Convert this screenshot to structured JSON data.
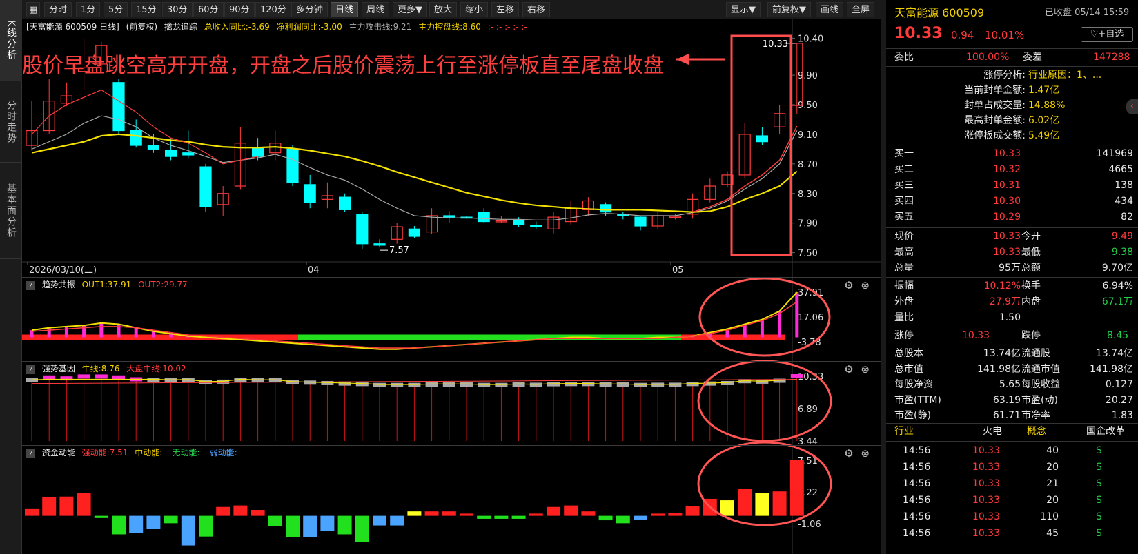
{
  "left_tabs": [
    "K线分析",
    "分时走势",
    "基本面分析"
  ],
  "toolbar": {
    "periods": [
      "分时",
      "1分",
      "5分",
      "15分",
      "30分",
      "60分",
      "90分",
      "120分",
      "多分钟",
      "日线",
      "周线",
      "更多▼",
      "放大",
      "缩小",
      "左移",
      "右移"
    ],
    "active": "日线",
    "right_buttons": [
      "显示▼",
      "前复权▼",
      "画线",
      "全屏"
    ]
  },
  "info_bar": {
    "title": "[天富能源 600509 日线]",
    "adj": "(前复权)",
    "indicator": "擒龙追踪",
    "rev_yoy": "总收入同比:-3.69",
    "profit_yoy": "净利润同比:-3.00",
    "attack": "主力攻击线:9.21",
    "control": "主力控盘线:8.60",
    "extra": ":- :- :- :- :-"
  },
  "annotation": "股价早盘跳空高开开盘，开盘之后股价震荡上行至涨停板直至尾盘收盘",
  "price_axis": [
    "10.40",
    "9.90",
    "9.50",
    "9.10",
    "8.70",
    "8.30",
    "7.90",
    "7.50"
  ],
  "date_labels": [
    "2026/03/10(二)",
    "04",
    "05"
  ],
  "high_label": "10.33",
  "low_label": "7.57",
  "panel1": {
    "name": "趋势共振",
    "out1": "OUT1:37.91",
    "out2": "OUT2:29.77",
    "axis": [
      "37.91",
      "17.06",
      "-3.78"
    ]
  },
  "panel2": {
    "name": "强势基因",
    "bull": "牛线:8.76",
    "mid": "大盘中线:10.02",
    "axis": [
      "10.33",
      "6.89",
      "3.44"
    ]
  },
  "panel3": {
    "name": "资金动能",
    "strong": "强动能:7.51",
    "medium": "中动能:-",
    "none": "无动能:-",
    "weak": "弱动能:-",
    "axis": [
      "7.51",
      "3.22",
      "-1.06"
    ]
  },
  "colors": {
    "up": "#ff3b3b",
    "down": "#00ffff",
    "ma_short": "#ff3b3b",
    "ma_mid": "#f1e000",
    "ma_long": "#aaaaaa"
  },
  "chart_data": [
    {
      "type": "candlestick",
      "title": "天富能源 600509 日线",
      "ohlc": [
        {
          "o": 8.95,
          "h": 9.55,
          "l": 8.88,
          "c": 9.15
        },
        {
          "o": 9.15,
          "h": 9.85,
          "l": 9.1,
          "c": 9.55
        },
        {
          "o": 9.52,
          "h": 9.8,
          "l": 9.48,
          "c": 9.62
        },
        {
          "o": 9.95,
          "h": 10.4,
          "l": 9.7,
          "c": 10.0
        },
        {
          "o": 10.05,
          "h": 10.35,
          "l": 9.95,
          "c": 10.3
        },
        {
          "o": 9.8,
          "h": 9.85,
          "l": 9.1,
          "c": 9.15
        },
        {
          "o": 9.15,
          "h": 9.3,
          "l": 8.92,
          "c": 8.95
        },
        {
          "o": 8.95,
          "h": 9.1,
          "l": 8.85,
          "c": 8.9
        },
        {
          "o": 8.88,
          "h": 9.05,
          "l": 8.75,
          "c": 8.8
        },
        {
          "o": 8.85,
          "h": 9.15,
          "l": 8.78,
          "c": 8.82
        },
        {
          "o": 8.66,
          "h": 8.7,
          "l": 8.05,
          "c": 8.12
        },
        {
          "o": 8.15,
          "h": 8.4,
          "l": 8.0,
          "c": 8.3
        },
        {
          "o": 8.4,
          "h": 9.2,
          "l": 8.35,
          "c": 8.98
        },
        {
          "o": 8.92,
          "h": 9.05,
          "l": 8.75,
          "c": 8.8
        },
        {
          "o": 8.85,
          "h": 9.15,
          "l": 8.75,
          "c": 8.98
        },
        {
          "o": 8.9,
          "h": 8.95,
          "l": 8.4,
          "c": 8.45
        },
        {
          "o": 8.42,
          "h": 8.55,
          "l": 8.1,
          "c": 8.18
        },
        {
          "o": 8.22,
          "h": 8.45,
          "l": 8.1,
          "c": 8.27
        },
        {
          "o": 8.25,
          "h": 8.3,
          "l": 8.05,
          "c": 8.08
        },
        {
          "o": 8.02,
          "h": 8.05,
          "l": 7.55,
          "c": 7.62
        },
        {
          "o": 7.62,
          "h": 7.68,
          "l": 7.57,
          "c": 7.6
        },
        {
          "o": 7.68,
          "h": 7.9,
          "l": 7.62,
          "c": 7.85
        },
        {
          "o": 7.82,
          "h": 7.86,
          "l": 7.7,
          "c": 7.72
        },
        {
          "o": 7.78,
          "h": 8.1,
          "l": 7.75,
          "c": 8.0
        },
        {
          "o": 8.0,
          "h": 8.06,
          "l": 7.9,
          "c": 7.98
        },
        {
          "o": 7.98,
          "h": 8.0,
          "l": 7.96,
          "c": 7.97
        },
        {
          "o": 8.05,
          "h": 8.1,
          "l": 7.9,
          "c": 7.92
        },
        {
          "o": 7.92,
          "h": 8.0,
          "l": 7.9,
          "c": 7.93
        },
        {
          "o": 7.94,
          "h": 7.98,
          "l": 7.85,
          "c": 7.88
        },
        {
          "o": 7.87,
          "h": 7.92,
          "l": 7.82,
          "c": 7.85
        },
        {
          "o": 7.82,
          "h": 8.05,
          "l": 7.76,
          "c": 7.98
        },
        {
          "o": 7.92,
          "h": 8.2,
          "l": 7.88,
          "c": 8.1
        },
        {
          "o": 8.08,
          "h": 8.25,
          "l": 8.0,
          "c": 8.2
        },
        {
          "o": 8.15,
          "h": 8.18,
          "l": 8.0,
          "c": 8.05
        },
        {
          "o": 8.02,
          "h": 8.05,
          "l": 7.95,
          "c": 8.0
        },
        {
          "o": 7.98,
          "h": 8.0,
          "l": 7.8,
          "c": 7.86
        },
        {
          "o": 7.86,
          "h": 8.05,
          "l": 7.82,
          "c": 8.0
        },
        {
          "o": 7.98,
          "h": 8.02,
          "l": 7.95,
          "c": 7.99
        },
        {
          "o": 8.02,
          "h": 8.3,
          "l": 7.96,
          "c": 8.22
        },
        {
          "o": 8.22,
          "h": 8.5,
          "l": 8.18,
          "c": 8.4
        },
        {
          "o": 8.42,
          "h": 8.6,
          "l": 8.38,
          "c": 8.55
        },
        {
          "o": 8.55,
          "h": 9.25,
          "l": 8.5,
          "c": 9.1
        },
        {
          "o": 9.08,
          "h": 9.2,
          "l": 8.95,
          "c": 9.0
        },
        {
          "o": 9.2,
          "h": 9.5,
          "l": 9.1,
          "c": 9.38
        },
        {
          "o": 9.49,
          "h": 10.33,
          "l": 9.38,
          "c": 10.33
        }
      ],
      "ma_attack": [
        9.1,
        9.35,
        9.5,
        9.6,
        9.7,
        9.55,
        9.4,
        9.2,
        9.05,
        8.98,
        8.85,
        8.7,
        8.75,
        8.8,
        8.88,
        8.78,
        8.65,
        8.58,
        8.5,
        8.38,
        8.25,
        8.15,
        8.05,
        8.02,
        8.0,
        8.0,
        7.98,
        7.97,
        7.96,
        7.95,
        7.95,
        7.98,
        8.02,
        8.04,
        8.03,
        8.0,
        8.0,
        8.0,
        8.05,
        8.12,
        8.22,
        8.4,
        8.55,
        8.75,
        9.21
      ],
      "ma_control": [
        8.85,
        8.9,
        8.95,
        9.0,
        9.08,
        9.1,
        9.08,
        9.05,
        9.02,
        9.0,
        8.96,
        8.93,
        8.92,
        8.92,
        8.93,
        8.91,
        8.88,
        8.84,
        8.8,
        8.74,
        8.67,
        8.59,
        8.52,
        8.45,
        8.38,
        8.31,
        8.26,
        8.21,
        8.17,
        8.14,
        8.12,
        8.1,
        8.09,
        8.08,
        8.08,
        8.08,
        8.07,
        8.06,
        8.05,
        8.06,
        8.12,
        8.22,
        8.3,
        8.4,
        8.6
      ],
      "ma_long": [
        8.9,
        9.0,
        9.1,
        9.25,
        9.35,
        9.3,
        9.2,
        9.05,
        8.95,
        8.88,
        8.8,
        8.72,
        8.75,
        8.78,
        8.83,
        8.76,
        8.65,
        8.55,
        8.48,
        8.36,
        8.22,
        8.1,
        8.0,
        7.98,
        7.97,
        7.97,
        7.96,
        7.95,
        7.95,
        7.94,
        7.94,
        7.97,
        8.01,
        8.03,
        8.02,
        8.0,
        8.0,
        8.0,
        8.04,
        8.1,
        8.2,
        8.36,
        8.5,
        8.7,
        9.15
      ]
    },
    {
      "type": "bar",
      "title": "趋势共振",
      "values": [
        6,
        8,
        9,
        10,
        12,
        11,
        8,
        5,
        3,
        1,
        0,
        -1,
        -2,
        -3,
        -4,
        -5,
        -6,
        -7,
        -8,
        -9,
        -10,
        -10,
        -9,
        -8,
        -7,
        -6,
        -5,
        -4,
        -3,
        -2,
        -1,
        0,
        0,
        -1,
        -1,
        -1,
        0,
        0,
        1,
        4,
        7,
        11,
        15,
        22,
        37.91
      ],
      "signal": [
        5,
        6,
        7,
        8,
        9,
        9,
        8,
        6,
        4,
        2,
        1,
        0,
        -1,
        -2,
        -3,
        -4,
        -5,
        -6,
        -7,
        -8,
        -9,
        -9,
        -9,
        -8,
        -7,
        -6,
        -5,
        -4,
        -3,
        -2,
        -1,
        -1,
        -1,
        -1,
        -1,
        -1,
        -1,
        0,
        1,
        3,
        6,
        10,
        14,
        20,
        29.77
      ],
      "ylim": [
        -3.78,
        37.91
      ]
    },
    {
      "type": "bar",
      "title": "强势基因",
      "values": [
        9.9,
        10.2,
        10.1,
        10.3,
        10.3,
        10.2,
        10.0,
        9.95,
        9.9,
        9.92,
        9.7,
        9.75,
        9.95,
        9.9,
        9.9,
        9.7,
        9.65,
        9.6,
        9.55,
        9.5,
        9.4,
        9.4,
        9.4,
        9.45,
        9.45,
        9.45,
        9.4,
        9.4,
        9.45,
        9.42,
        9.48,
        9.5,
        9.5,
        9.45,
        9.45,
        9.4,
        9.42,
        9.42,
        9.5,
        9.55,
        9.6,
        9.8,
        9.75,
        9.85,
        10.33
      ],
      "ylim": [
        3.44,
        10.33
      ]
    },
    {
      "type": "bar",
      "title": "资金动能",
      "values": [
        1.0,
        2.5,
        2.6,
        3.1,
        -0.3,
        -2.5,
        -2.3,
        -1.8,
        -1.0,
        -4.0,
        -2.8,
        1.2,
        1.4,
        0.8,
        -1.4,
        -2.9,
        -2.9,
        -2.0,
        -2.5,
        -3.5,
        -1.3,
        -1.3,
        0.6,
        0.6,
        0.6,
        0.3,
        -0.4,
        -0.4,
        -0.4,
        0.3,
        1.2,
        1.4,
        0.6,
        -0.6,
        -1.0,
        -0.5,
        0.3,
        0.4,
        1.3,
        2.3,
        2.1,
        3.6,
        3.1,
        3.3,
        7.51
      ],
      "ylim": [
        -1.06,
        7.51
      ]
    }
  ],
  "quote": {
    "name": "天富能源 600509",
    "status": "已收盘 05/14 15:59",
    "price": "10.33",
    "change": "0.94",
    "pct": "10.01%",
    "fav": "+自选",
    "weibi_label": "委比",
    "weibi": "100.00%",
    "weicha_label": "委差",
    "weicha": "147288",
    "limit_analysis": [
      {
        "label": "涨停分析:",
        "value": "行业原因：1、..."
      },
      {
        "label": "当前封单金额:",
        "value": "1.47亿"
      },
      {
        "label": "封单占成交量:",
        "value": "14.88%"
      },
      {
        "label": "最高封单金额:",
        "value": "6.02亿"
      },
      {
        "label": "涨停板成交额:",
        "value": "5.49亿"
      }
    ],
    "bids": [
      {
        "label": "买一",
        "price": "10.33",
        "vol": "141969"
      },
      {
        "label": "买二",
        "price": "10.32",
        "vol": "4665"
      },
      {
        "label": "买三",
        "price": "10.31",
        "vol": "138"
      },
      {
        "label": "买四",
        "price": "10.30",
        "vol": "434"
      },
      {
        "label": "买五",
        "price": "10.29",
        "vol": "82"
      }
    ],
    "stats1": [
      {
        "l1": "现价",
        "v1": "10.33",
        "c1": "red",
        "l2": "今开",
        "v2": "9.49",
        "c2": "red"
      },
      {
        "l1": "最高",
        "v1": "10.33",
        "c1": "red",
        "l2": "最低",
        "v2": "9.38",
        "c2": "green"
      },
      {
        "l1": "总量",
        "v1": "95万",
        "c1": "white",
        "l2": "总额",
        "v2": "9.70亿",
        "c2": "white"
      }
    ],
    "stats2": [
      {
        "l1": "振幅",
        "v1": "10.12%",
        "c1": "red",
        "l2": "换手",
        "v2": "6.94%",
        "c2": "white"
      },
      {
        "l1": "外盘",
        "v1": "27.9万",
        "c1": "red",
        "l2": "内盘",
        "v2": "67.1万",
        "c2": "green"
      },
      {
        "l1": "量比",
        "v1": "1.50",
        "c1": "white",
        "l2": "",
        "v2": "",
        "c2": "white"
      }
    ],
    "limits": {
      "up_label": "涨停",
      "up": "10.33",
      "down_label": "跌停",
      "down": "8.45"
    },
    "fundamentals": [
      {
        "l1": "总股本",
        "v1": "13.74亿",
        "l2": "流通股",
        "v2": "13.74亿"
      },
      {
        "l1": "总市值",
        "v1": "141.98亿",
        "l2": "流通市值",
        "v2": "141.98亿"
      },
      {
        "l1": "每股净资",
        "v1": "5.65",
        "l2": "每股收益",
        "v2": "0.127"
      },
      {
        "l1": "市盈(TTM)",
        "v1": "63.19",
        "l2": "市盈(动)",
        "v2": "20.27"
      },
      {
        "l1": "市盈(静)",
        "v1": "61.71",
        "l2": "市净率",
        "v2": "1.83"
      }
    ],
    "industry": {
      "l1": "行业",
      "v1": "火电",
      "l2": "概念",
      "v2": "国企改革"
    },
    "ticks": [
      {
        "time": "14:56",
        "price": "10.33",
        "vol": "40",
        "side": "S"
      },
      {
        "time": "14:56",
        "price": "10.33",
        "vol": "20",
        "side": "S"
      },
      {
        "time": "14:56",
        "price": "10.33",
        "vol": "21",
        "side": "S"
      },
      {
        "time": "14:56",
        "price": "10.33",
        "vol": "20",
        "side": "S"
      },
      {
        "time": "14:56",
        "price": "10.33",
        "vol": "110",
        "side": "S"
      },
      {
        "time": "14:56",
        "price": "10.33",
        "vol": "45",
        "side": "S"
      }
    ]
  }
}
